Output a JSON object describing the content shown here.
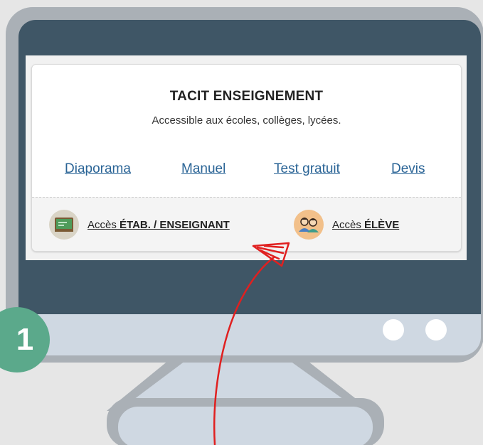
{
  "step": {
    "number": "1"
  },
  "card": {
    "title": "TACIT ENSEIGNEMENT",
    "subtitle": "Accessible aux écoles, collèges, lycées."
  },
  "nav": {
    "links": [
      {
        "label": "Diaporama"
      },
      {
        "label": "Manuel"
      },
      {
        "label": "Test gratuit"
      },
      {
        "label": "Devis"
      }
    ]
  },
  "access": {
    "teacher": {
      "prefix": "Accès ",
      "strong": "ÉTAB. / ENSEIGNANT",
      "icon": "chalkboard-icon"
    },
    "student": {
      "prefix": "Accès ",
      "strong": "ÉLÈVE",
      "icon": "students-icon"
    }
  },
  "colors": {
    "screen": "#3f5666",
    "frame": "#aab0b6",
    "chin": "#cfd8e2",
    "badge": "#5ba98b",
    "link": "#2a6496",
    "arrow": "#e02020"
  }
}
